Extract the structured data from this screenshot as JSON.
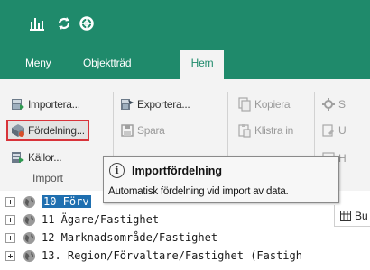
{
  "quick_access": {
    "icons": [
      "bar-chart-icon",
      "sync-icon",
      "lifebuoy-icon"
    ]
  },
  "tabs": [
    {
      "label": "Meny"
    },
    {
      "label": "Objektträd"
    },
    {
      "label": "Hem",
      "active": true
    }
  ],
  "ribbon": {
    "import_group": {
      "label": "Import",
      "items": [
        {
          "label": "Importera...",
          "icon": "import-icon"
        },
        {
          "label": "Fördelning...",
          "icon": "distribution-icon",
          "highlighted": true
        },
        {
          "label": "Källor...",
          "icon": "sources-icon"
        }
      ]
    },
    "file_group": {
      "items": [
        {
          "label": "Exportera...",
          "icon": "export-icon"
        },
        {
          "label": "Spara",
          "icon": "save-icon",
          "disabled": true
        }
      ]
    },
    "clipboard_group": {
      "items": [
        {
          "label": "Kopiera",
          "icon": "copy-icon",
          "disabled": true
        },
        {
          "label": "Klistra in",
          "icon": "paste-icon",
          "disabled": true
        }
      ]
    },
    "truncated_group": {
      "items": [
        {
          "label": "S",
          "icon": "settings-icon"
        },
        {
          "label": "U",
          "icon": "update-icon"
        },
        {
          "label": "H",
          "icon": "help-icon"
        }
      ]
    }
  },
  "tooltip": {
    "title": "Importfördelning",
    "description": "Automatisk fördelning vid import av data."
  },
  "tree": {
    "rows": [
      {
        "label": "10 Förv",
        "selected": true
      },
      {
        "label": "11 Ägare/Fastighet"
      },
      {
        "label": "12 Marknadsområde/Fastighet"
      },
      {
        "label": "13. Region/Förvaltare/Fastighet (Fastigh"
      }
    ]
  },
  "doc_tab": {
    "label": "Bu"
  },
  "colors": {
    "brand": "#1f8a6b",
    "highlight_border": "#d8333a",
    "selection": "#1f6fb0"
  }
}
